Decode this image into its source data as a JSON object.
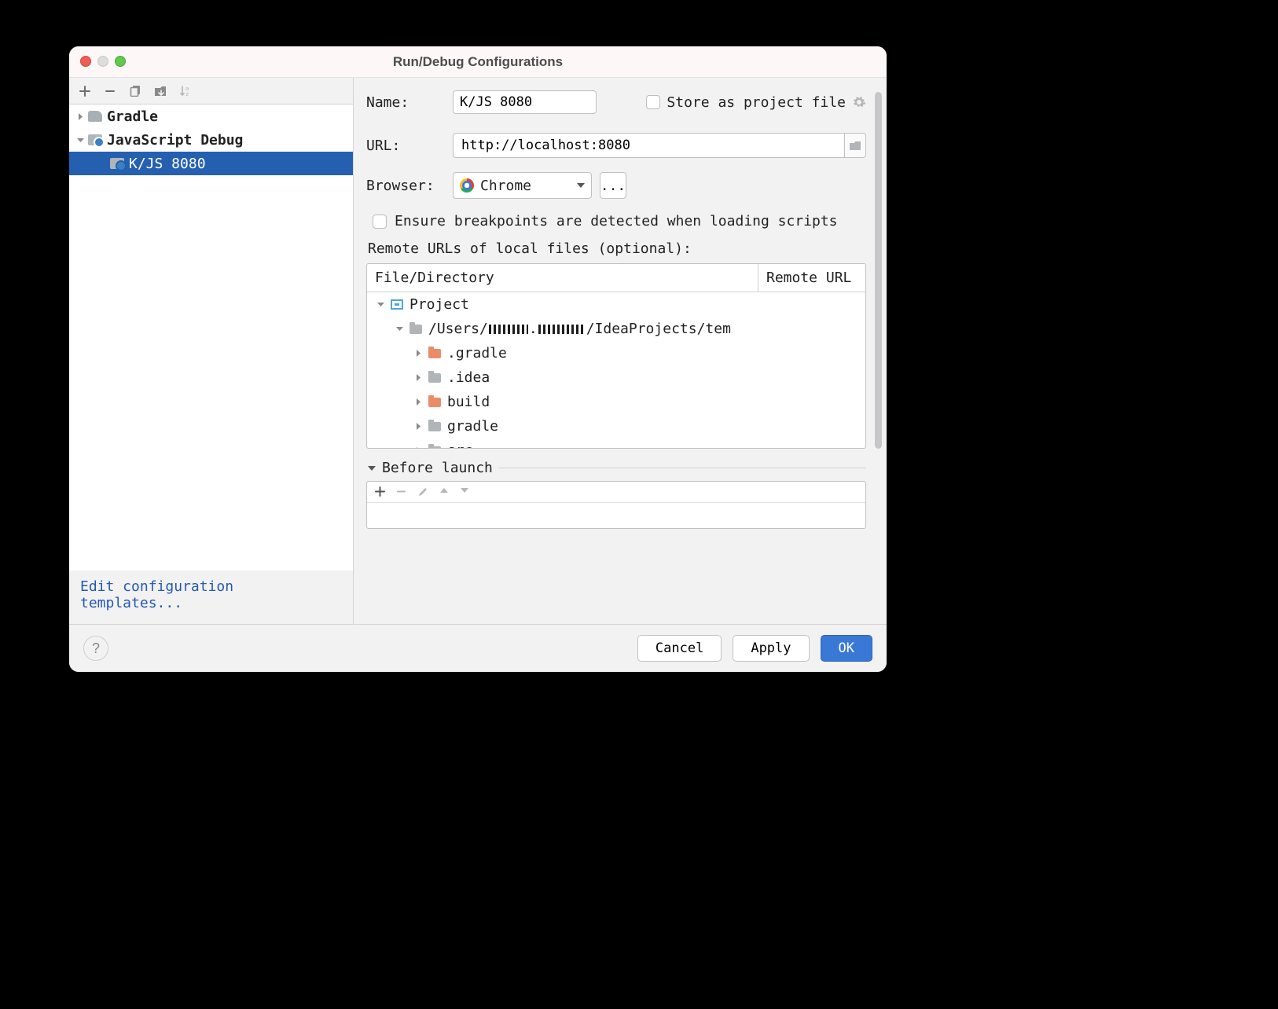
{
  "title": "Run/Debug Configurations",
  "sidebar": {
    "gradle": "Gradle",
    "jsdebug": "JavaScript Debug",
    "kjs": "K/JS 8080",
    "edit_templates": "Edit configuration templates..."
  },
  "form": {
    "name_label": "Name:",
    "name_value": "K/JS 8080",
    "store_label": "Store as project file",
    "url_label": "URL:",
    "url_value": "http://localhost:8080",
    "browser_label": "Browser:",
    "browser_value": "Chrome",
    "more": "...",
    "ensure_label": "Ensure breakpoints are detected when loading scripts",
    "remote_label": "Remote URLs of local files (optional):"
  },
  "rtable": {
    "col1": "File/Directory",
    "col2": "Remote URL",
    "rows": {
      "project": "Project",
      "userpath_a": "/Users/",
      "userpath_b": "/IdeaProjects/tem",
      "g1": ".gradle",
      "g2": ".idea",
      "g3": "build",
      "g4": "gradle",
      "g5": "src"
    }
  },
  "before_launch": "Before launch",
  "footer": {
    "cancel": "Cancel",
    "apply": "Apply",
    "ok": "OK"
  }
}
